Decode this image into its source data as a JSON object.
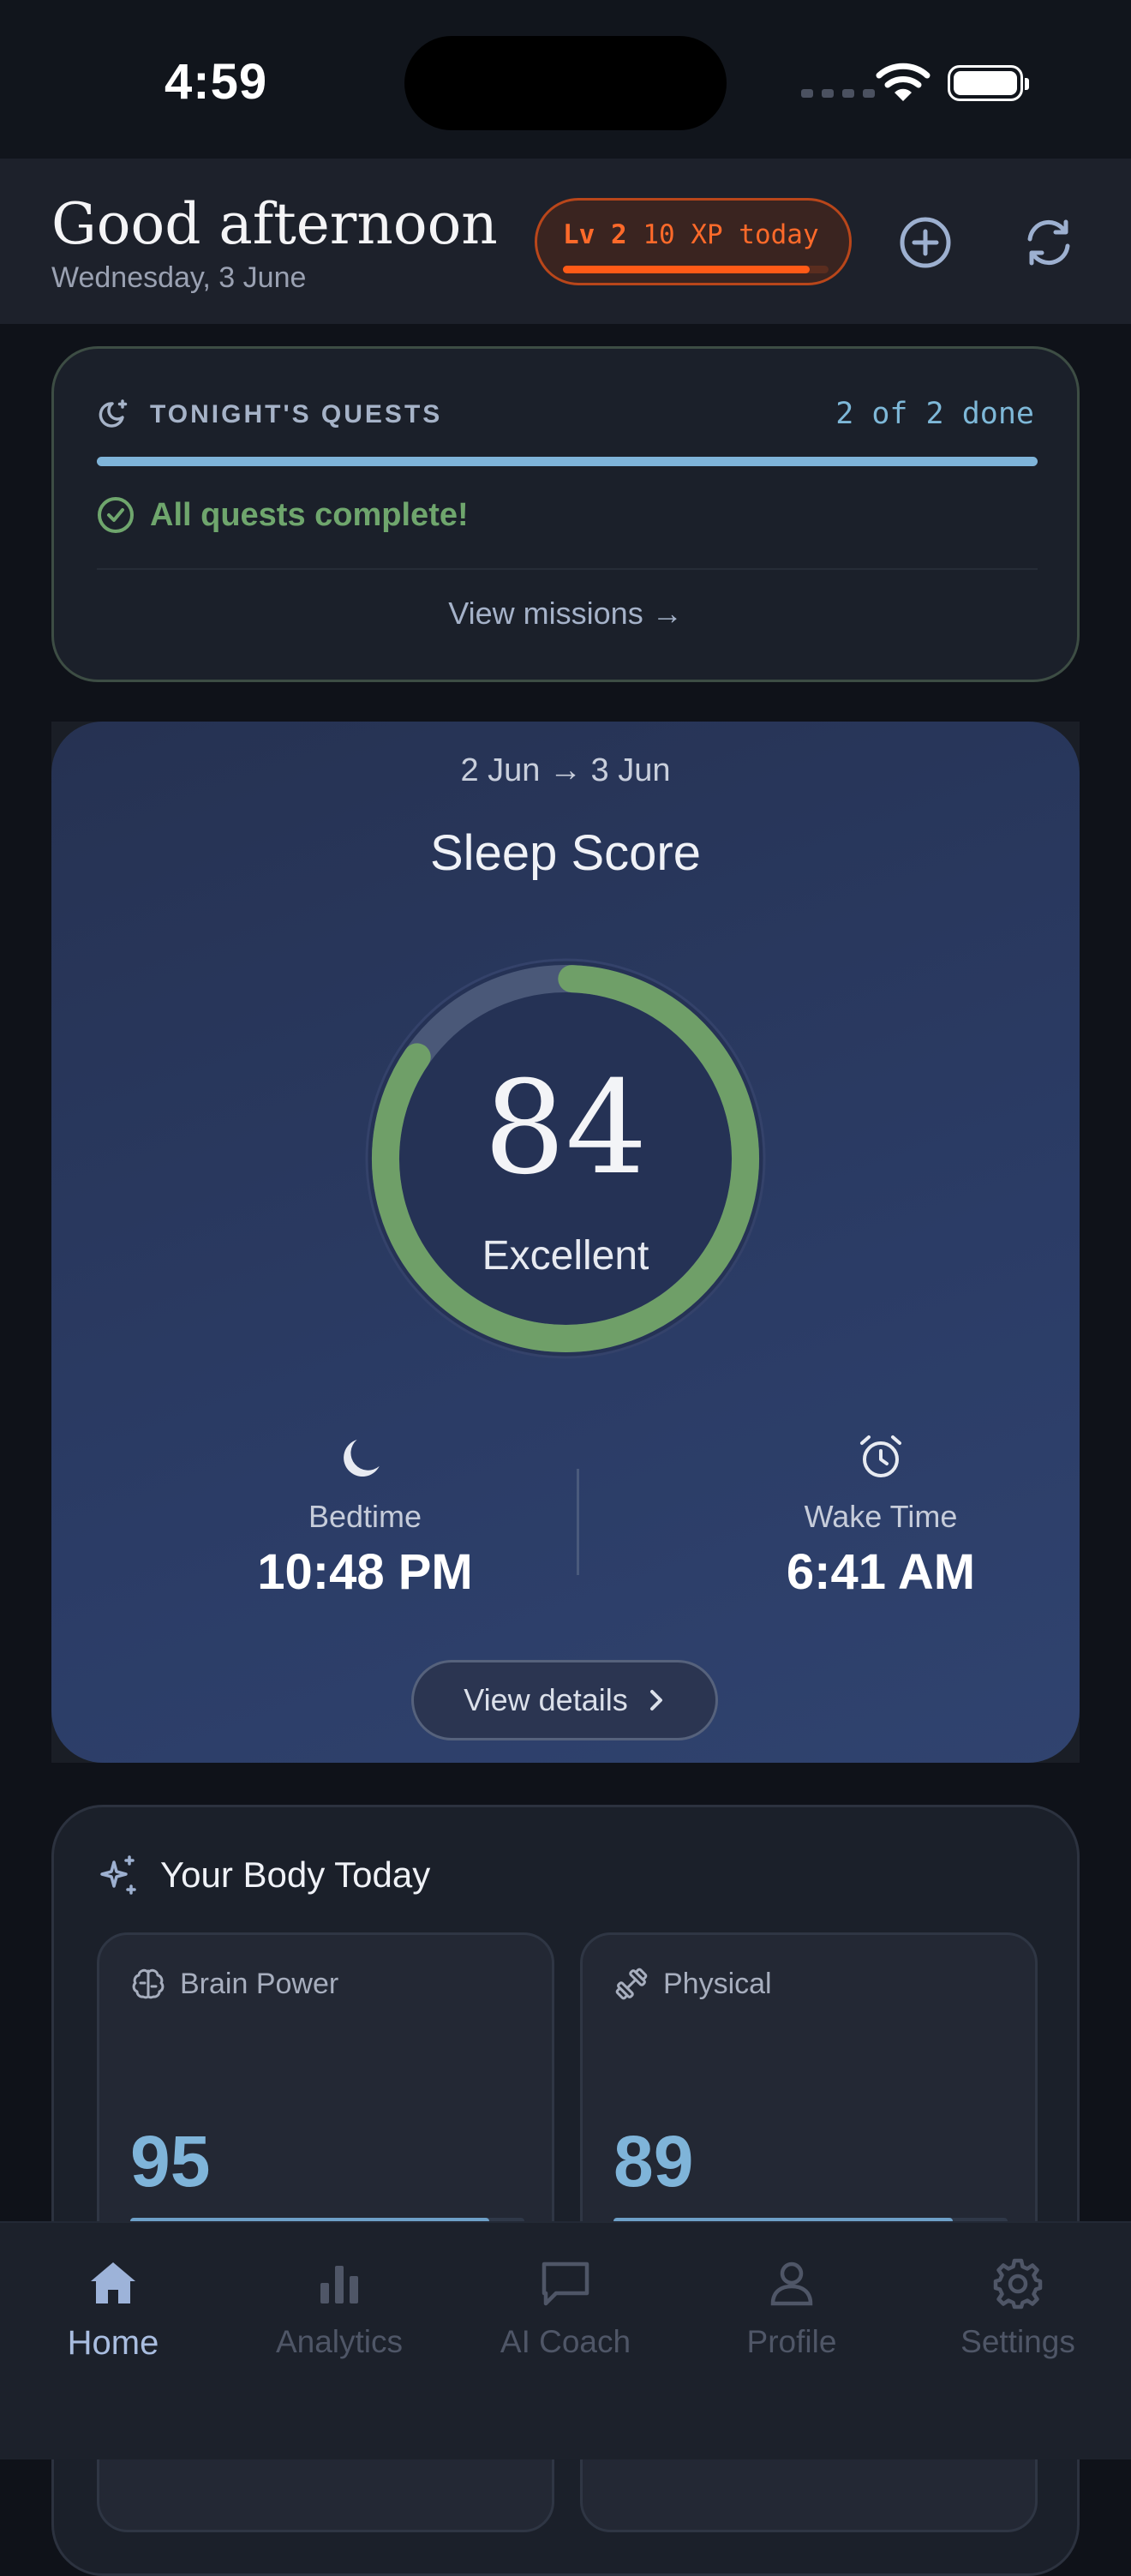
{
  "status_bar": {
    "time": "4:59"
  },
  "header": {
    "greeting": "Good afternoon",
    "date": "Wednesday, 3 June",
    "xp": {
      "level": "Lv 2",
      "today": "10 XP today",
      "progress": 0.93
    }
  },
  "quests": {
    "title": "TONIGHT'S QUESTS",
    "count": "2 of 2 done",
    "progress": 1.0,
    "complete_text": "All quests complete!",
    "link": "View missions →"
  },
  "sleep": {
    "date_range": "2 Jun → 3 Jun",
    "title": "Sleep Score",
    "score": "84",
    "score_value": 84,
    "rating": "Excellent",
    "bedtime": {
      "label": "Bedtime",
      "value": "10:48 PM"
    },
    "wake": {
      "label": "Wake Time",
      "value": "6:41 AM"
    },
    "details_button": "View details"
  },
  "body_today": {
    "title": "Your Body Today",
    "cards": [
      {
        "label": "Brain Power",
        "value": "95",
        "progress": 0.91
      },
      {
        "label": "Physical",
        "value": "89",
        "progress": 0.86
      }
    ]
  },
  "tabs": [
    {
      "label": "Home",
      "active": true
    },
    {
      "label": "Analytics"
    },
    {
      "label": "AI Coach"
    },
    {
      "label": "Profile"
    },
    {
      "label": "Settings"
    }
  ],
  "colors": {
    "accent_blue": "#7fb4d9",
    "success_green": "#6fa66d",
    "xp_orange": "#ff5a17",
    "sleep_card": "#2b3c66"
  }
}
